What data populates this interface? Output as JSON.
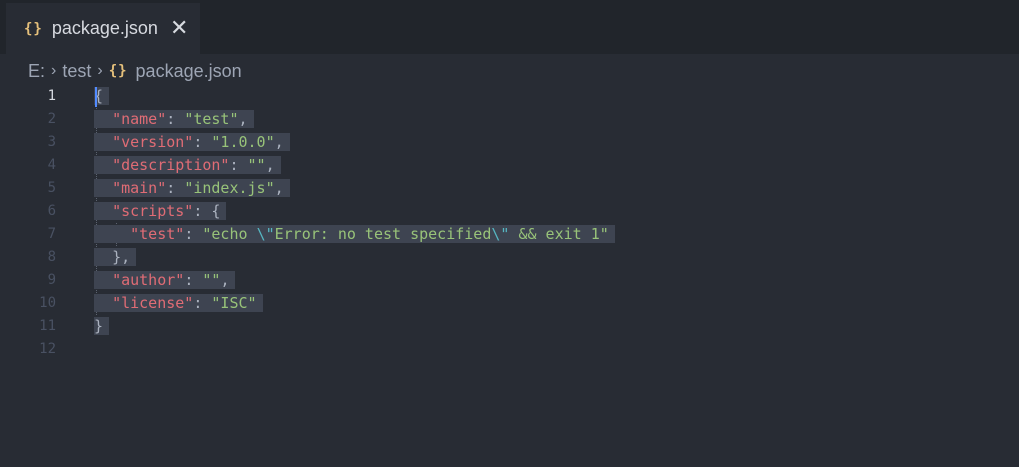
{
  "tab": {
    "icon": "json-braces-icon",
    "icon_text": "{}",
    "label": "package.json",
    "close": "✕"
  },
  "breadcrumb": {
    "drive": "E:",
    "folder": "test",
    "file_icon_text": "{}",
    "file": "package.json",
    "separator": "›"
  },
  "editor": {
    "active_line": 1,
    "line_numbers": [
      "1",
      "2",
      "3",
      "4",
      "5",
      "6",
      "7",
      "8",
      "9",
      "10",
      "11",
      "12"
    ],
    "lines": [
      "{",
      "  \"name\": \"test\",",
      "  \"version\": \"1.0.0\",",
      "  \"description\": \"\",",
      "  \"main\": \"index.js\",",
      "  \"scripts\": {",
      "    \"test\": \"echo \\\"Error: no test specified\\\" && exit 1\"",
      "  },",
      "  \"author\": \"\",",
      "  \"license\": \"ISC\"",
      "}",
      ""
    ]
  },
  "colors": {
    "background": "#282c34",
    "tabbar": "#21252b",
    "key": "#e06c75",
    "string": "#98c379",
    "escape": "#56b6c2",
    "selection": "#3e4451",
    "json_icon": "#e5c07b"
  }
}
